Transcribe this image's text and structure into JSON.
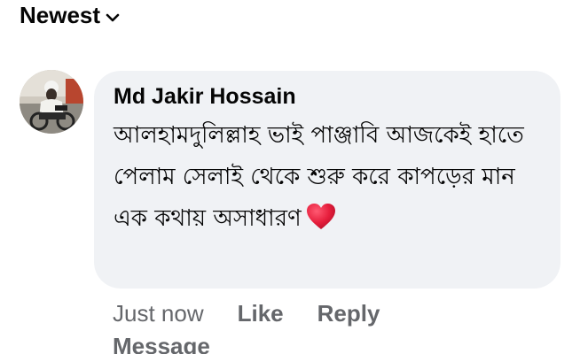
{
  "sort": {
    "label": "Newest",
    "icon": "chevron-down-icon"
  },
  "comment": {
    "author": "Md Jakir Hossain",
    "text": "আলহামদুলিল্লাহ ভাই পাঞ্জাবি আজকেই হাতে পেলাম সেলাই থেকে শুরু করে কাপড়ের মান এক কথায় অসাধারণ",
    "emoji": "heart-icon",
    "timestamp": "Just now",
    "like_label": "Like",
    "reply_label": "Reply",
    "message_label": "Message"
  },
  "colors": {
    "bubble_bg": "#f0f2f5",
    "meta_text": "#65676b",
    "primary_text": "#050505",
    "heart": "#e0245e"
  }
}
